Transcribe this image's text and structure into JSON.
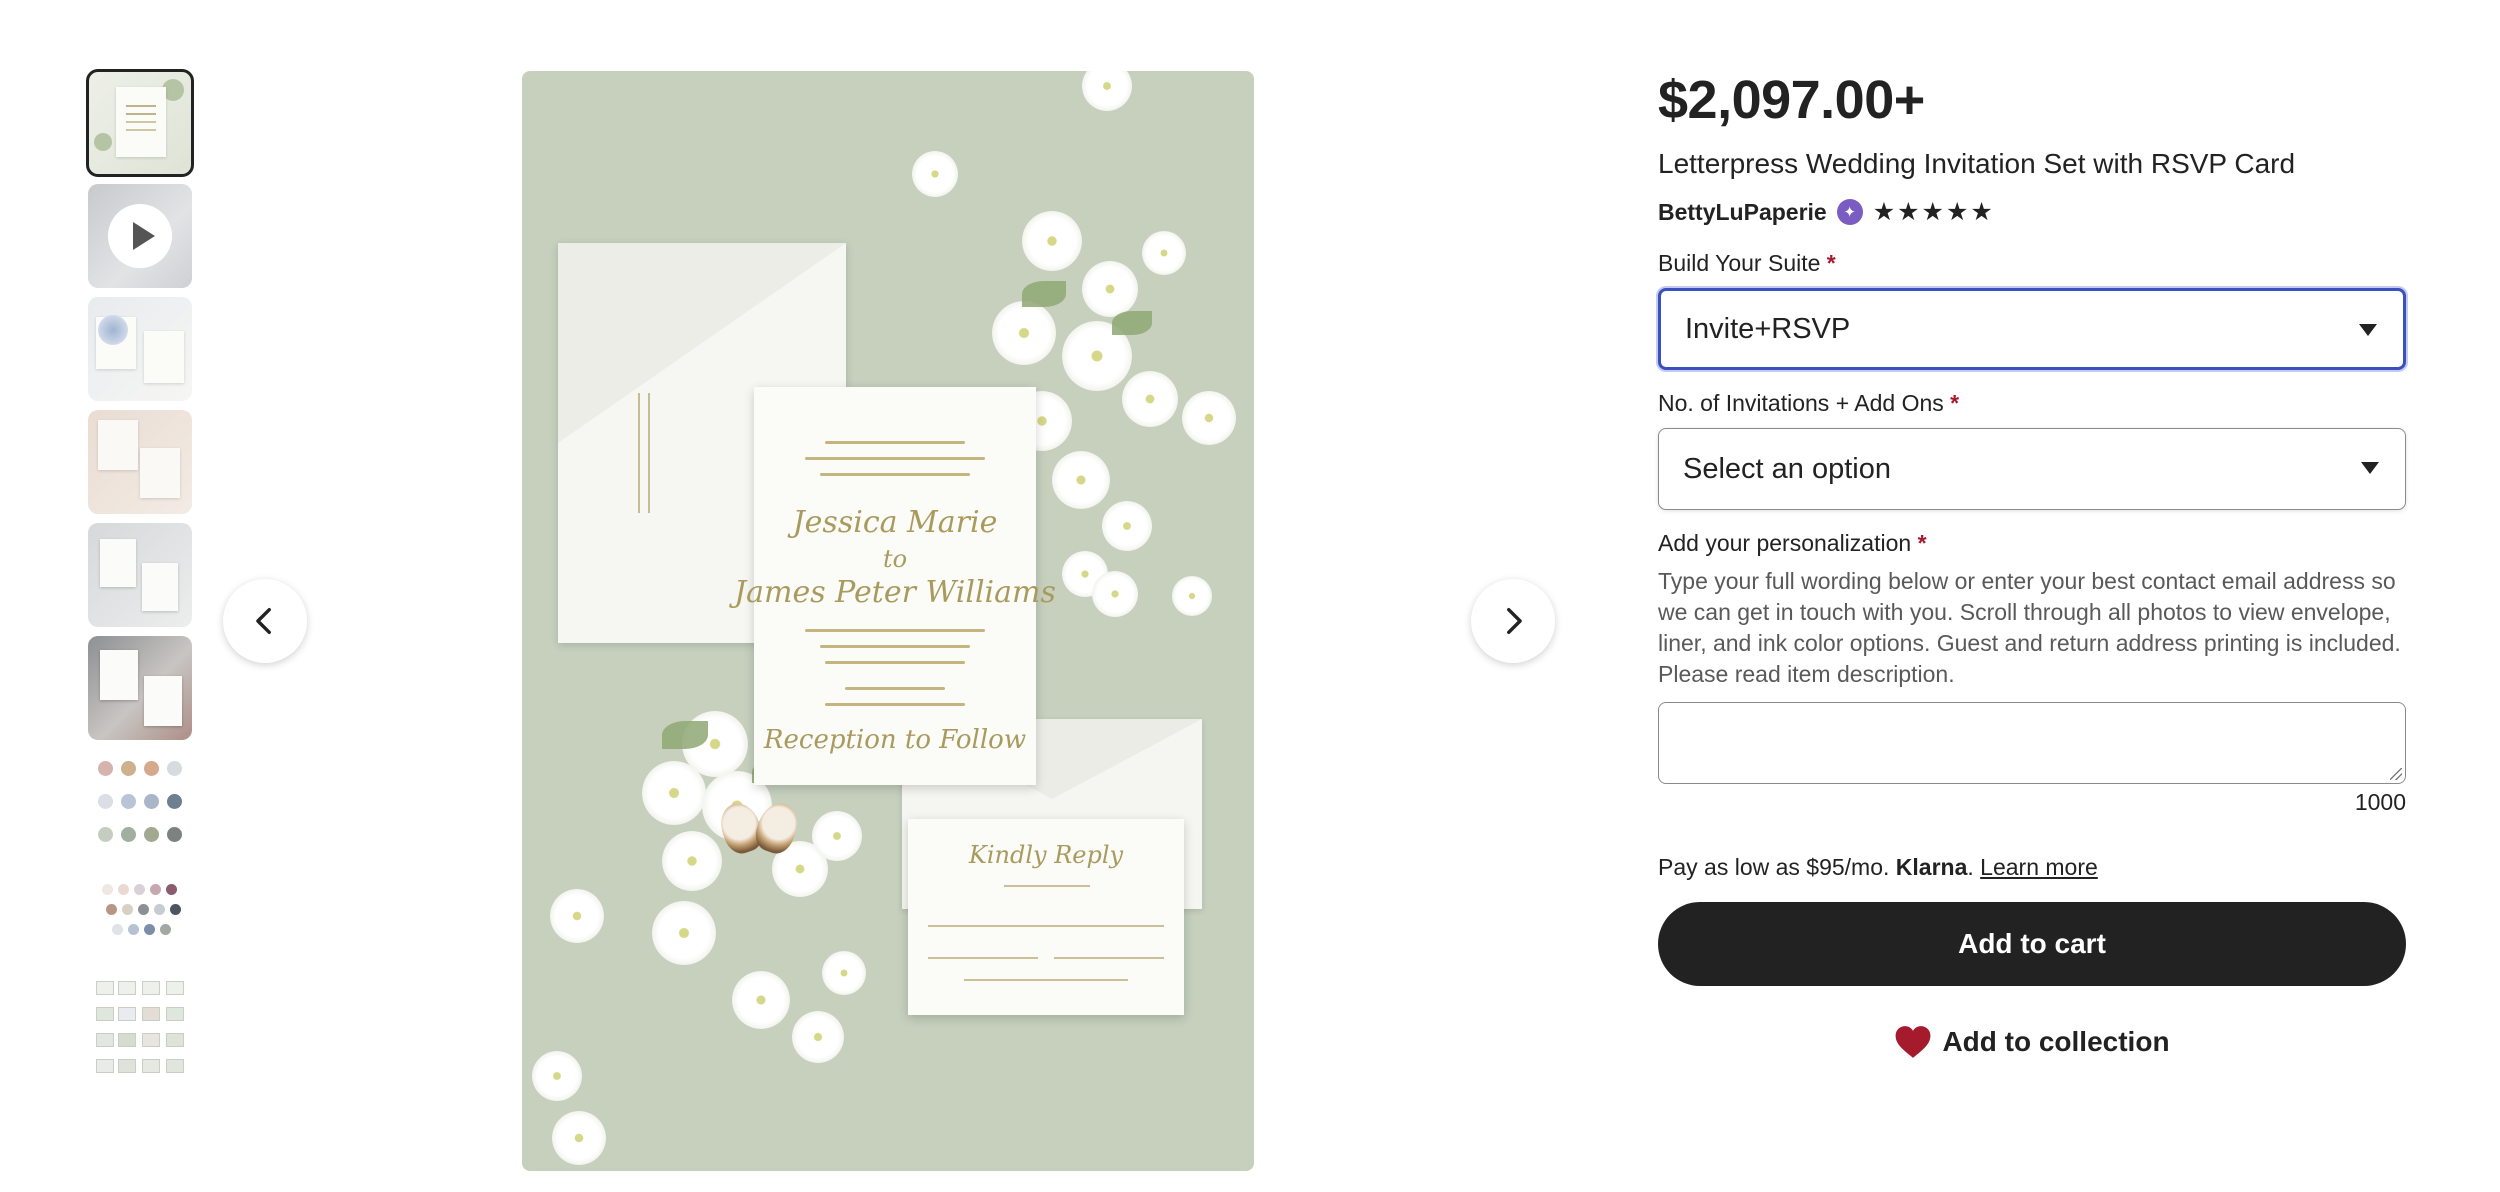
{
  "gallery": {
    "thumbnails": [
      {
        "name": "invite-front"
      },
      {
        "name": "video"
      },
      {
        "name": "blue-floral-suite"
      },
      {
        "name": "blush-suite"
      },
      {
        "name": "grey-suite"
      },
      {
        "name": "dark-suite"
      },
      {
        "name": "ink-color-swatches"
      },
      {
        "name": "envelope-color-swatches"
      },
      {
        "name": "liner-options"
      }
    ],
    "icons": {
      "prev": "chevron-left-icon",
      "next": "chevron-right-icon",
      "play": "play-icon"
    }
  },
  "listing": {
    "price": "$2,097.00+",
    "title": "Letterpress Wedding Invitation Set with RSVP Card",
    "shop_name": "BettyLuPaperie",
    "stars": "★★★★★",
    "star_seller_icon": "star-seller-badge-icon"
  },
  "options": {
    "suite": {
      "label": "Build Your Suite",
      "required_mark": "*",
      "value": "Invite+RSVP"
    },
    "invitations": {
      "label": "No. of Invitations + Add Ons",
      "required_mark": "*",
      "value": "Select an option"
    }
  },
  "personalization": {
    "label": "Add your personalization",
    "required_mark": "*",
    "instructions": "Type your full wording below or enter your best contact email address so we can get in touch with you. Scroll through all photos to view envelope, liner, and ink color options. Guest and return address printing is included. Please read item description.",
    "value": "",
    "char_limit": "1000"
  },
  "financing": {
    "text": "Pay as low as $95/mo.",
    "brand": "Klarna",
    "separator": ".",
    "link": "Learn more"
  },
  "actions": {
    "add_to_cart": "Add to cart",
    "add_to_collection": "Add to collection"
  },
  "colors": {
    "accent_focus": "#3b4fbf",
    "required": "#a61a2e",
    "cart_button": "#222222",
    "heart": "#a61a2e",
    "star_seller": "#7b5cc2"
  }
}
